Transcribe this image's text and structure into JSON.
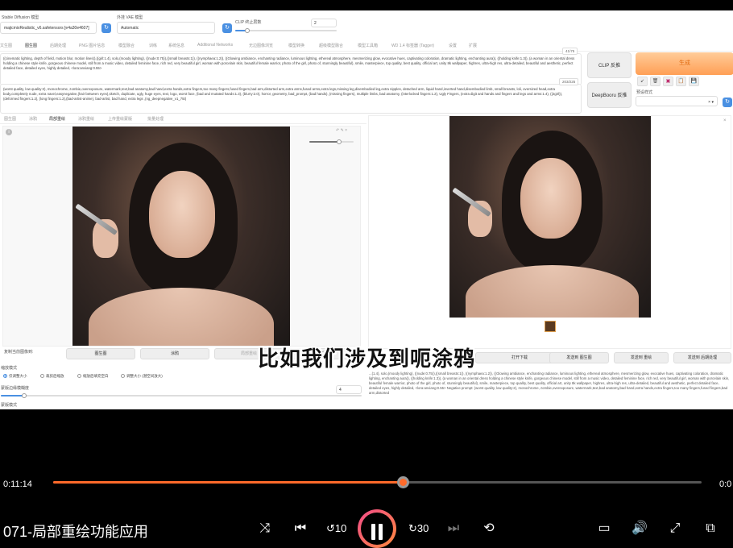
{
  "webui": {
    "model_label": "Stable Diffusion 模型",
    "model_value": "majicmixRealistic_v6.safetensors [e4a30e4607]",
    "vae_label": "外挂 VAE 模型",
    "vae_value": "Automatic",
    "clip_label": "CLIP 终止层数",
    "clip_value": "2",
    "tabs": [
      "文生图",
      "图生图",
      "后期处理",
      "PNG 图片信息",
      "模型融合",
      "训练",
      "系统信息",
      "Additional Networks",
      "无边图像浏览",
      "模型转换",
      "超级模型融合",
      "模型工具箱",
      "WD 1.4 标签器 (Tagger)",
      "设置",
      "扩展"
    ],
    "positive_prompt": "((cinematic lighting, depth of field, motion blur, motion lines)),((girl:1.4), solo,(moody lighting), ((nude:0.75)),((small breasts:1)), ((nymphaea:1.2)), ((Glowing ambiance, enchanting radiance, luminous lighting, ethereal atmosphere, mesmerizing glow, evocative hues, captivating coloration, dramatic lighting, enchanting aura)), ((holding knife:1.3)), (a woman in an oriental dress holding a chinese style knife, gorgeous chinese model, still from a music video, detailed feminine face, rich red, very beautiful girl, woman with porcelain skin, beautiful female warrior, photo of the girl, photo of, stunningly beautiful), smile, masterpiece, top quality, best quality, official art, unity 8k wallpaper, highres, ultra-high res, ultra-detailed, beautiful and aesthetic, perfect detailed face, detailed eyes, highly detailed, <lora:anviang:0.55>",
    "positive_count": "41/75",
    "negative_prompt": "(worst quality, low quality:2), monochrome, zombie,overexposure, watermark,text,bad anatomy,bad hand,extra hands,extra fingers,too many fingers,fused fingers,bad arm,distorted arm,extra arms,fused arms,extra legs,missing leg,disembodied leg,extra nipples, detached arm, liquid hand,inverted hand,disembodied limb, small breasts, loli, oversized head,extra body,completely nude, extra navel,easynegative,(hair between eyes),sketch, duplicate, ugly, huge eyes, text, logo, worst face, (bad and mutated hands:1.3), (blurry:2.0), horror, geometry, bad_prompt, (bad hands), (missing fingers), multiple limbs, bad anatomy, (interlocked fingers:1.2), Ugly Fingers, (extra digit and hands and fingers and legs and arms:1.4), ((2girl)), (deformed fingers:1.2), (long fingers:1.2),(bad-artist-anime), bad-artist, bad hand, extra legs ,(ng_deepnegative_v1_75t)",
    "negative_count": "203/225",
    "clip_button": "CLIP 反推",
    "deepbooru_button": "DeepBooru 反推",
    "generate_button": "生成",
    "preset_label": "预设样式",
    "mini_buttons": [
      "↙",
      "🗑",
      "▣",
      "📋",
      "💾"
    ],
    "subtabs": [
      "图生图",
      "涂鸦",
      "局部重绘",
      "涂鸦重绘",
      "上传重绘蒙版",
      "批量处理"
    ],
    "copy_to_label": "复制当前图像到:",
    "copy_buttons": [
      "图生图",
      "涂鸦",
      "局部重绘",
      "涂鸦重绘"
    ],
    "resize_mode_label": "缩放模式",
    "resize_modes": [
      "仅调整大小",
      "裁剪后缩放",
      "缩放后填充空白",
      "调整大小 (潜空间放大)"
    ],
    "mask_blur_label": "蒙版边缘模糊度",
    "mask_blur_value": "4",
    "mask_mode_label": "蒙版模式",
    "output_buttons": [
      "打开下载",
      "发送到 图生图",
      "发送到 重绘",
      "发送到 后期处理"
    ],
    "info_text": "...(1.4), solo,(moody lighting), ((nude:0.75)),((small breasts:1)), ((nymphaea:1.2)), ((Glowing ambiance, enchanting radiance, luminous lighting, ethereal atmosphere, mesmerizing glow, evocative hues, captivating coloration, dramatic lighting, enchanting aura)), ((holding knife:1.3)), (a woman in an oriental dress holding a chinese style knife, gorgeous chinese model, still from a music video, detailed feminine face, rich red, very beautiful girl, woman with porcelain skin, beautiful female warrior, photo of the girl, photo of, stunningly beautiful), smile, masterpiece, top quality, best quality, official art, unity 8k wallpaper, highres, ultra-high res, ultra-detailed, beautiful and aesthetic, perfect detailed face, detailed eyes, highly detailed, <lora:anviang:0.55> Negative prompt: (worst quality, low quality:2), monochrome, zombie,overexposure, watermark,text,bad anatomy,bad hand,extra hands,extra fingers,too many fingers,fused fingers,bad arm,distorted"
  },
  "subtitle": "比如我们涉及到呃涂鸦",
  "player": {
    "current_time": "0:11:14",
    "total_time": "0:0",
    "progress": 0.539,
    "title": "071-局部重绘功能应用",
    "accent": "#ff6a2a"
  },
  "icons": [
    "shuffle-icon",
    "previous-icon",
    "rewind-10-icon",
    "pause-icon",
    "forward-30-icon",
    "next-icon",
    "loop-icon",
    "subtitles-icon",
    "volume-icon",
    "fullscreen-icon",
    "pip-icon"
  ]
}
